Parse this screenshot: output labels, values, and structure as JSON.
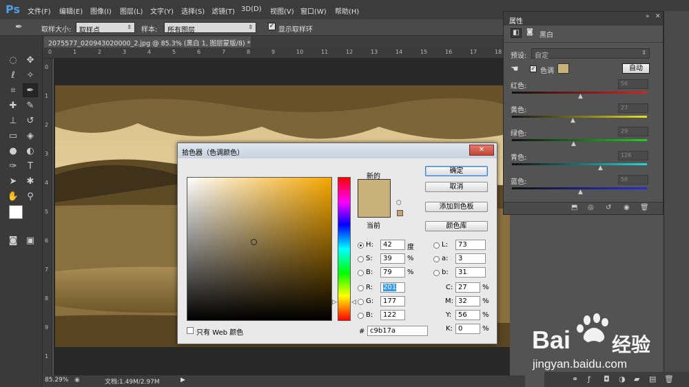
{
  "menubar": {
    "logo": "Ps",
    "items": [
      "文件(F)",
      "编辑(E)",
      "图像(I)",
      "图层(L)",
      "文字(Y)",
      "选择(S)",
      "滤镜(T)",
      "3D(D)",
      "视图(V)",
      "窗口(W)",
      "帮助(H)"
    ]
  },
  "options": {
    "sample_size_label": "取样大小:",
    "sample_size_value": "取样点",
    "sample_label": "样本:",
    "sample_value": "所有图层",
    "show_ring_label": "显示取样环"
  },
  "document": {
    "tab_title": "2075577_020943020000_2.jpg @ 85.3% (黑白 1, 图层蒙版/8) *",
    "tab_close": "×"
  },
  "ruler": {
    "h_ticks": [
      "0",
      "1",
      "2",
      "3",
      "4",
      "5",
      "6",
      "7",
      "8",
      "9",
      "10",
      "11",
      "12",
      "13",
      "14",
      "15",
      "16",
      "17",
      "18"
    ],
    "v_ticks": [
      "0",
      "1",
      "2",
      "3",
      "4",
      "5",
      "6",
      "7",
      "8",
      "9",
      "1"
    ]
  },
  "status": {
    "zoom": "85.29%",
    "doc_size": "文档:1.49M/2.97M"
  },
  "color_picker": {
    "title": "拾色器（色调颜色）",
    "close_label": "✕",
    "new_label": "新的",
    "current_label": "当前",
    "new_color": "#c9b17a",
    "current_color": "#c9b17a",
    "ok_button": "确定",
    "cancel_button": "取消",
    "add_swatch_button": "添加到色板",
    "color_library_button": "颜色库",
    "hsb": [
      {
        "label": "H:",
        "value": "42",
        "unit": "度"
      },
      {
        "label": "S:",
        "value": "39",
        "unit": "%"
      },
      {
        "label": "B:",
        "value": "79",
        "unit": "%"
      }
    ],
    "rgb": [
      {
        "label": "R:",
        "value": "201"
      },
      {
        "label": "G:",
        "value": "177"
      },
      {
        "label": "B:",
        "value": "122"
      }
    ],
    "lab": [
      {
        "label": "L:",
        "value": "73"
      },
      {
        "label": "a:",
        "value": "3"
      },
      {
        "label": "b:",
        "value": "31"
      }
    ],
    "cmyk": [
      {
        "label": "C:",
        "value": "27",
        "unit": "%"
      },
      {
        "label": "M:",
        "value": "32",
        "unit": "%"
      },
      {
        "label": "Y:",
        "value": "56",
        "unit": "%"
      },
      {
        "label": "K:",
        "value": "0",
        "unit": "%"
      }
    ],
    "hex_label": "#",
    "hex_value": "c9b17a",
    "web_only_label": "只有 Web 颜色"
  },
  "properties": {
    "panel_title": "属性",
    "adjustment_name": "黑白",
    "preset_label": "预设:",
    "preset_value": "自定",
    "tint_label": "色调",
    "tint_color": "#c9b17a",
    "auto_button": "自动",
    "sliders": [
      {
        "label": "红色:",
        "value": "56"
      },
      {
        "label": "黄色:",
        "value": "27"
      },
      {
        "label": "绿色:",
        "value": "29"
      },
      {
        "label": "青色:",
        "value": "126"
      },
      {
        "label": "蓝色:",
        "value": "56"
      }
    ]
  },
  "watermark": {
    "brand": "Bai",
    "brand_suffix": "经验",
    "url": "jingyan.baidu.com"
  }
}
